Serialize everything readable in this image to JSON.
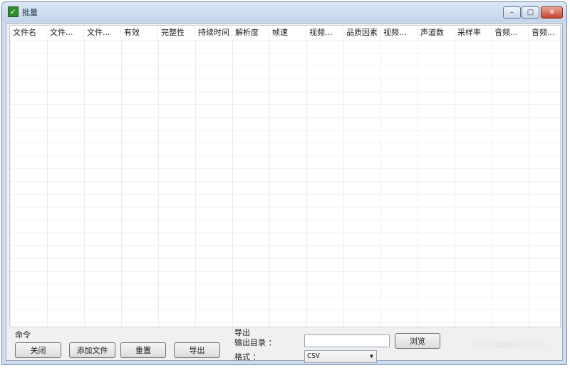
{
  "window": {
    "title": "批量",
    "icon": "app-check-icon",
    "controls": {
      "minimize": "–",
      "maximize": "□",
      "close": "✕"
    }
  },
  "table": {
    "columns": [
      "文件名",
      "文件...",
      "文件...",
      "有效",
      "完整性",
      "持续时间",
      "解析度",
      "帧速",
      "视频...",
      "品质因素",
      "视频...",
      "声道数",
      "采样率",
      "音频...",
      "音频..."
    ],
    "rows": []
  },
  "command": {
    "label": "命令",
    "buttons": {
      "close": "关闭",
      "add_file": "添加文件",
      "reset": "重置",
      "export": "导出"
    }
  },
  "export": {
    "label": "导出",
    "output_dir_label": "输出目录 ：",
    "output_dir_value": "",
    "browse": "浏览",
    "format_label": "格式 ：",
    "format_value": "CSV"
  }
}
